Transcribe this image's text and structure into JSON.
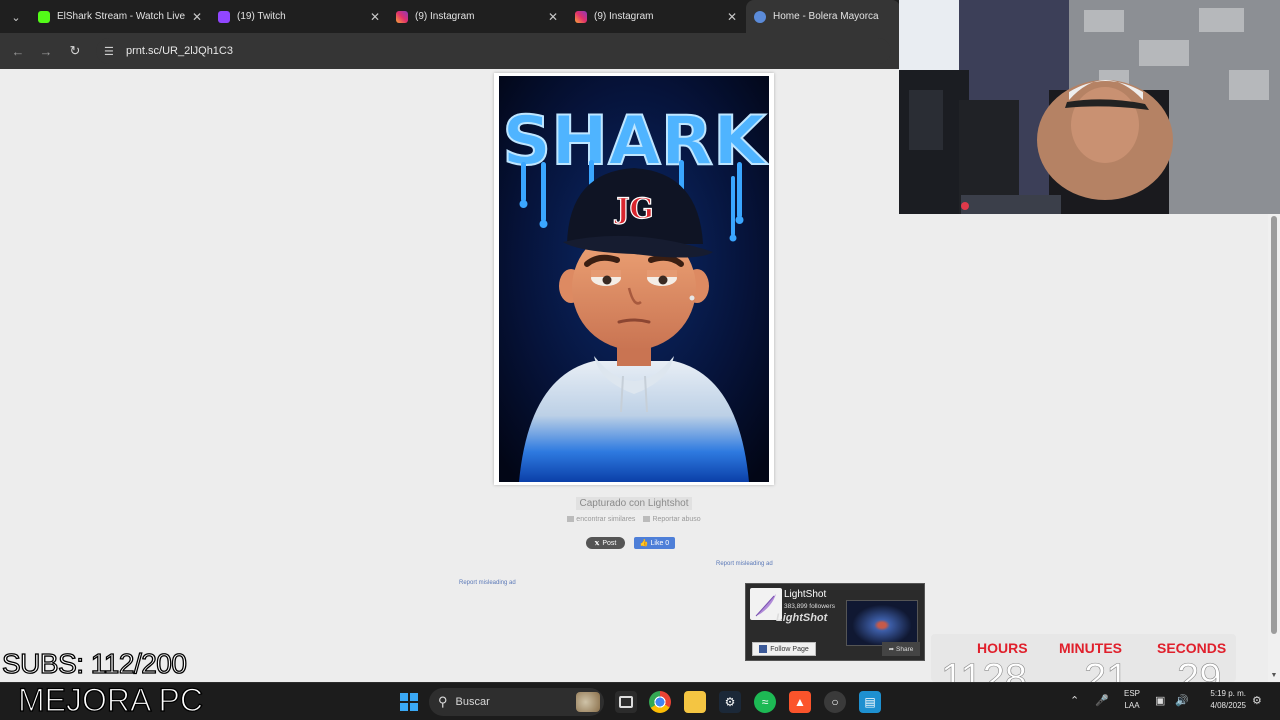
{
  "browser": {
    "tabs": [
      {
        "title": "ElShark Stream - Watch Live",
        "icon": "kick-icon",
        "color": "#53fc18",
        "active": false
      },
      {
        "title": "(19) Twitch",
        "icon": "twitch-icon",
        "color": "#9146ff",
        "active": false
      },
      {
        "title": "(9) Instagram",
        "icon": "instagram-icon",
        "color": "#e1306c",
        "active": false
      },
      {
        "title": "(9) Instagram",
        "icon": "instagram-icon",
        "color": "#e1306c",
        "active": false
      },
      {
        "title": "Home - Bolera Mayorca",
        "icon": "globe-icon",
        "color": "#5b8bd9",
        "active": true
      }
    ],
    "url": "prnt.sc/UR_2lJQh1C3"
  },
  "page": {
    "image_title": "SHARK",
    "cap_logo": "JG",
    "caption": "Capturado con Lightshot",
    "find_similar": "encontrar similares",
    "report_abuse": "Reportar abuso",
    "post_label": "Post",
    "like_label": "Like 0",
    "report_ad_1": "Report misleading ad",
    "report_ad_2": "Report misleading ad"
  },
  "fb_widget": {
    "name": "LightShot",
    "followers": "383,899 followers",
    "brand": "LightShot",
    "follow_label": "Follow Page",
    "share_label": "Share"
  },
  "overlay": {
    "subs": "SUBS: 112/200",
    "mejora": "MEJORA PC",
    "timer": {
      "hours_label": "HOURS",
      "minutes_label": "MINUTES",
      "seconds_label": "SECONDS",
      "hours": "1128",
      "minutes": "21",
      "seconds": "29",
      "label_color": "#e0202c"
    }
  },
  "taskbar": {
    "search_placeholder": "Buscar",
    "lang_1": "ESP",
    "lang_2": "LAA",
    "time": "5:19 p. m.",
    "date": "4/08/2025",
    "accent": "#3aa8f4"
  }
}
